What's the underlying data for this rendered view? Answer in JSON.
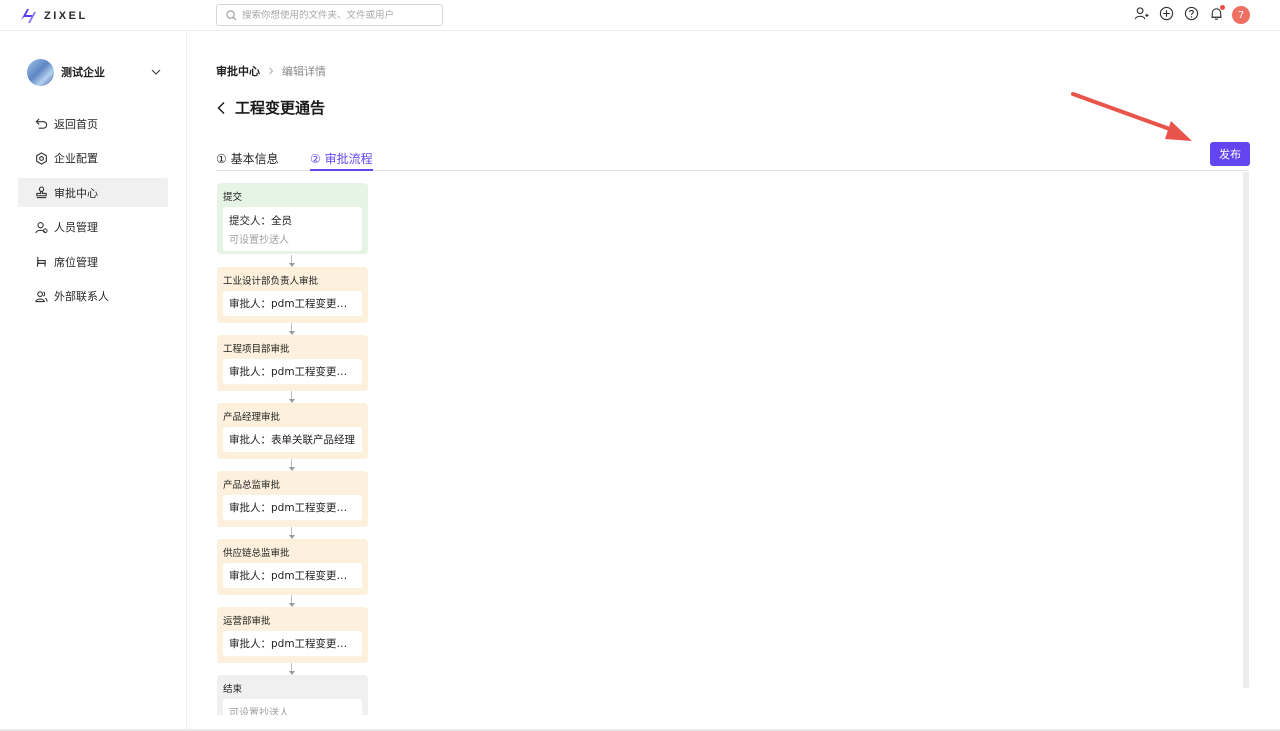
{
  "header": {
    "brand": "ZIXEL",
    "search_placeholder": "搜索你想使用的文件夹、文件或用户",
    "notification_count": "7",
    "icons": [
      "add-user-icon",
      "plus-circle-icon",
      "help-icon",
      "bell-icon"
    ]
  },
  "sidebar": {
    "org_name": "测试企业",
    "items": [
      {
        "label": "返回首页",
        "icon": "return-icon"
      },
      {
        "label": "企业配置",
        "icon": "gear-icon"
      },
      {
        "label": "审批中心",
        "icon": "stamp-icon",
        "active": true
      },
      {
        "label": "人员管理",
        "icon": "user-icon"
      },
      {
        "label": "席位管理",
        "icon": "seat-icon"
      },
      {
        "label": "外部联系人",
        "icon": "contacts-icon"
      }
    ]
  },
  "breadcrumb": {
    "parent": "审批中心",
    "current": "编辑详情"
  },
  "page": {
    "title": "工程变更通告"
  },
  "tabs": [
    {
      "label": "① 基本信息",
      "active": false
    },
    {
      "label": "② 审批流程",
      "active": true
    }
  ],
  "actions": {
    "publish_label": "发布"
  },
  "colors": {
    "accent": "#6446f0",
    "submit_node": "#e6f4e6",
    "approval_node": "#fdf0dc",
    "end_node": "#f0f0f0",
    "annotation_arrow": "#e8534a"
  },
  "flow": {
    "nodes": [
      {
        "title": "提交",
        "body": "提交人：全员",
        "sub": "可设置抄送人",
        "kind": "green"
      },
      {
        "title": "工业设计部负责人审批",
        "body": "审批人：pdm工程变更流程",
        "kind": "orange"
      },
      {
        "title": "工程项目部审批",
        "body": "审批人：pdm工程变更流程",
        "kind": "orange"
      },
      {
        "title": "产品经理审批",
        "body": "审批人：表单关联产品经理",
        "kind": "orange"
      },
      {
        "title": "产品总监审批",
        "body": "审批人：pdm工程变更流程",
        "kind": "orange"
      },
      {
        "title": "供应链总监审批",
        "body": "审批人：pdm工程变更流程",
        "kind": "orange"
      },
      {
        "title": "运营部审批",
        "body": "审批人：pdm工程变更流程",
        "kind": "orange"
      },
      {
        "title": "结束",
        "sub": "可设置抄送人",
        "kind": "grey"
      }
    ]
  }
}
